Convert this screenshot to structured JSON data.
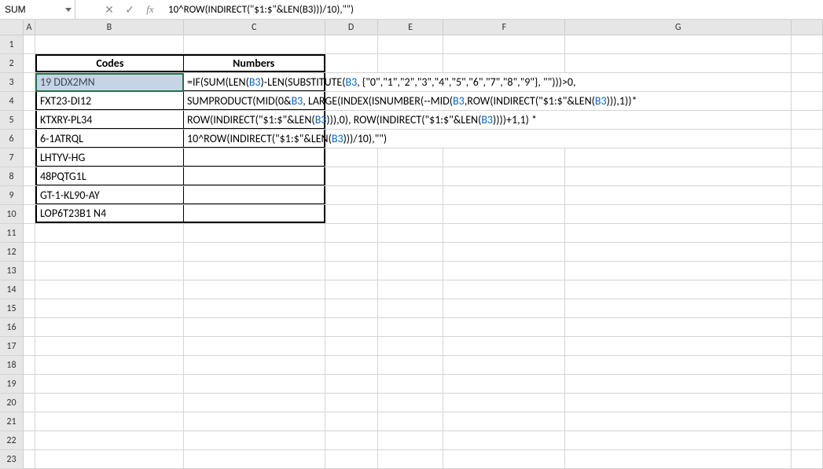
{
  "name_box": "SUM",
  "formula_display": "10^ROW(INDIRECT(\"$1:$\"&LEN(B3)))/10),\"\")",
  "icons": {
    "cancel": "✕",
    "confirm": "✓",
    "fx": "fx"
  },
  "col_headers": [
    "A",
    "B",
    "C",
    "D",
    "E",
    "F",
    "G"
  ],
  "row_headers": [
    "1",
    "2",
    "3",
    "4",
    "5",
    "6",
    "7",
    "8",
    "9",
    "10",
    "11",
    "12",
    "13",
    "14",
    "15",
    "16",
    "17",
    "18",
    "19",
    "20",
    "21",
    "22",
    "23"
  ],
  "table": {
    "header": {
      "codes": "Codes",
      "numbers": "Numbers"
    },
    "rows": [
      {
        "code": "19 DDX2MN"
      },
      {
        "code": "FXT23-DI12"
      },
      {
        "code": "KTXRY-PL34"
      },
      {
        "code": "6-1ATRQL"
      },
      {
        "code": "LHTYV-HG"
      },
      {
        "code": "48PQTG1L"
      },
      {
        "code": "GT-1-KL90-AY"
      },
      {
        "code": "LOP6T23B1 N4"
      }
    ]
  },
  "formula_lines": [
    {
      "pre1": "=IF(SUM(LEN(",
      "ref1": "B3",
      "mid1": ")-LEN(SUBSTITUTE(",
      "ref2": "B3",
      "post1": ", {\"0\",\"1\",\"2\",\"3\",\"4\",\"5\",\"6\",\"7\",\"8\",\"9\"}, \"\")))>0,"
    },
    {
      "pre1": "SUMPRODUCT(MID(0&",
      "ref1": "B3",
      "mid1": ", LARGE(INDEX(ISNUMBER(--MID(",
      "ref2": "B3",
      "mid2": ",ROW(INDIRECT(\"$1:$\"&LEN(",
      "ref3": "B3",
      "post1": "))),1))*"
    },
    {
      "pre1": "ROW(INDIRECT(\"$1:$\"&LEN(",
      "ref1": "B3",
      "mid1": "))),0), ROW(INDIRECT(\"$1:$\"&LEN(",
      "ref2": "B3",
      "post1": "))))+1,1) *"
    },
    {
      "pre1": "10^ROW(INDIRECT(\"$1:$\"&LEN(",
      "ref1": "B3",
      "post1": ")))/10),\"\")"
    }
  ]
}
